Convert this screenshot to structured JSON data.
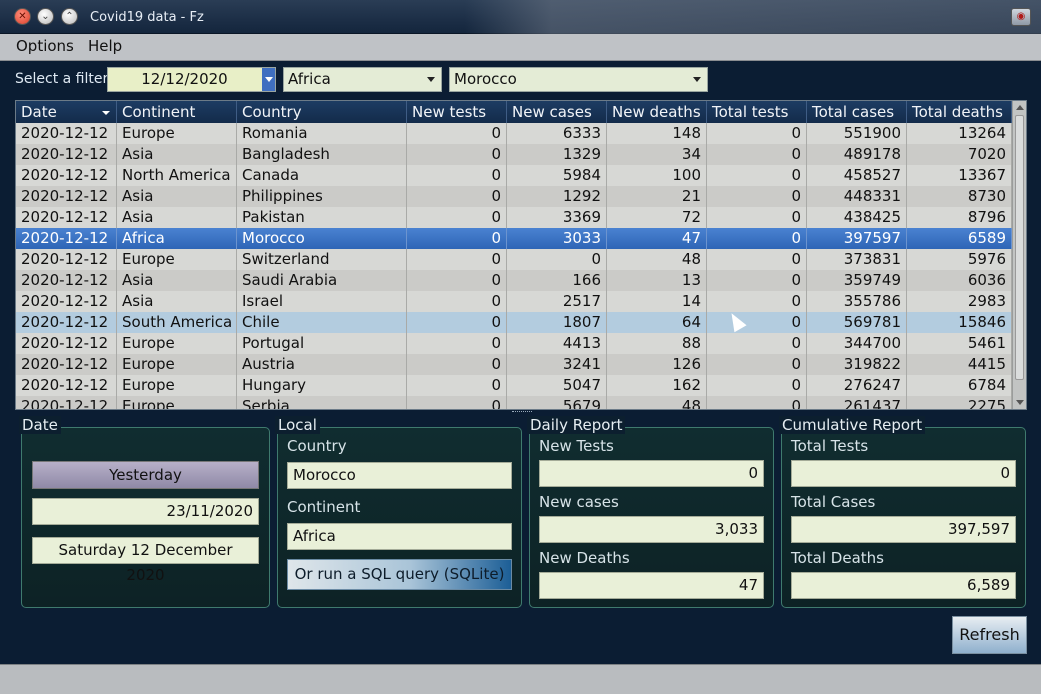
{
  "window": {
    "title": "Covid19 data - Fz",
    "icon": "app-icon"
  },
  "menu": [
    "Options",
    "Help"
  ],
  "filter": {
    "label": "Select a filter",
    "date": "12/12/2020",
    "continent": "Africa",
    "country": "Morocco"
  },
  "table": {
    "columns": [
      "Date",
      "Continent",
      "Country",
      "New tests",
      "New cases",
      "New deaths",
      "Total tests",
      "Total cases",
      "Total deaths"
    ],
    "rows": [
      [
        "2020-12-12",
        "Europe",
        "Romania",
        "0",
        "6333",
        "148",
        "0",
        "551900",
        "13264"
      ],
      [
        "2020-12-12",
        "Asia",
        "Bangladesh",
        "0",
        "1329",
        "34",
        "0",
        "489178",
        "7020"
      ],
      [
        "2020-12-12",
        "North America",
        "Canada",
        "0",
        "5984",
        "100",
        "0",
        "458527",
        "13367"
      ],
      [
        "2020-12-12",
        "Asia",
        "Philippines",
        "0",
        "1292",
        "21",
        "0",
        "448331",
        "8730"
      ],
      [
        "2020-12-12",
        "Asia",
        "Pakistan",
        "0",
        "3369",
        "72",
        "0",
        "438425",
        "8796"
      ],
      [
        "2020-12-12",
        "Africa",
        "Morocco",
        "0",
        "3033",
        "47",
        "0",
        "397597",
        "6589"
      ],
      [
        "2020-12-12",
        "Europe",
        "Switzerland",
        "0",
        "0",
        "48",
        "0",
        "373831",
        "5976"
      ],
      [
        "2020-12-12",
        "Asia",
        "Saudi Arabia",
        "0",
        "166",
        "13",
        "0",
        "359749",
        "6036"
      ],
      [
        "2020-12-12",
        "Asia",
        "Israel",
        "0",
        "2517",
        "14",
        "0",
        "355786",
        "2983"
      ],
      [
        "2020-12-12",
        "South America",
        "Chile",
        "0",
        "1807",
        "64",
        "0",
        "569781",
        "15846"
      ],
      [
        "2020-12-12",
        "Europe",
        "Portugal",
        "0",
        "4413",
        "88",
        "0",
        "344700",
        "5461"
      ],
      [
        "2020-12-12",
        "Europe",
        "Austria",
        "0",
        "3241",
        "126",
        "0",
        "319822",
        "4415"
      ],
      [
        "2020-12-12",
        "Europe",
        "Hungary",
        "0",
        "5047",
        "162",
        "0",
        "276247",
        "6784"
      ],
      [
        "2020-12-12",
        "Europe",
        "Serbia",
        "0",
        "5679",
        "48",
        "0",
        "261437",
        "2275"
      ]
    ],
    "selected_index": 5,
    "hover_index": 9
  },
  "date_group": {
    "title": "Date",
    "yesterday_label": "Yesterday",
    "yesterday_value": "23/11/2020",
    "long_date": "Saturday 12 December 2020"
  },
  "local_group": {
    "title": "Local",
    "country_label": "Country",
    "country": "Morocco",
    "continent_label": "Continent",
    "continent": "Africa",
    "sql_button": "Or run a SQL query (SQLite)"
  },
  "daily_group": {
    "title": "Daily Report",
    "new_tests_label": "New Tests",
    "new_tests": "0",
    "new_cases_label": "New cases",
    "new_cases": "3,033",
    "new_deaths_label": "New Deaths",
    "new_deaths": "47"
  },
  "cumulative_group": {
    "title": "Cumulative Report",
    "total_tests_label": "Total Tests",
    "total_tests": "0",
    "total_cases_label": "Total Cases",
    "total_cases": "397,597",
    "total_deaths_label": "Total Deaths",
    "total_deaths": "6,589"
  },
  "refresh_button": "Refresh"
}
